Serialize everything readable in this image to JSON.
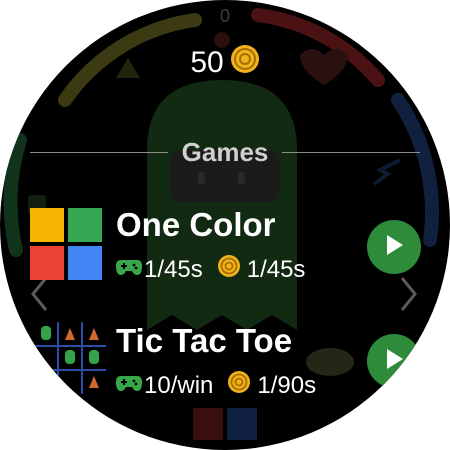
{
  "top_counter": "0",
  "coins": {
    "value": "50",
    "icon": "coin-icon"
  },
  "section": {
    "title": "Games"
  },
  "games": [
    {
      "title": "One Color",
      "stat_controller": "1/45s",
      "stat_coin": "1/45s",
      "icon": "one-color-grid-icon",
      "colors": [
        "#f4b400",
        "#34a853",
        "#ea4335",
        "#4285f4"
      ]
    },
    {
      "title": "Tic Tac Toe",
      "stat_controller": "10/win",
      "stat_coin": "1/90s",
      "icon": "tic-tac-toe-board-icon"
    }
  ],
  "accent": {
    "play": "#2e8b3a",
    "controller": "#37a84a",
    "coin": "#f0b41b"
  }
}
